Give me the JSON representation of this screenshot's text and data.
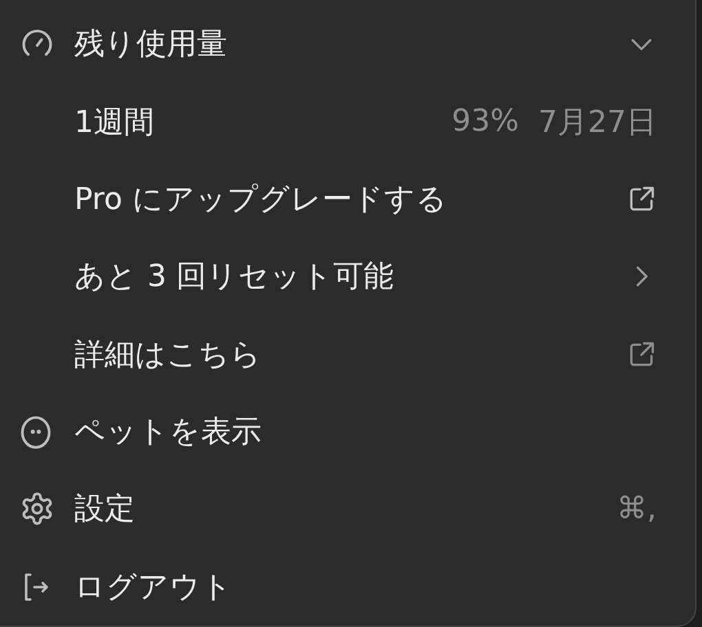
{
  "menu": {
    "items": [
      {
        "kind": "section",
        "label": "残り使用量",
        "expanded": true
      },
      {
        "kind": "usage",
        "label": "1週間",
        "percent": "93%",
        "date": "7月27日"
      },
      {
        "kind": "link",
        "label": "Pro にアップグレードする"
      },
      {
        "kind": "submenu",
        "label": "あと 3 回リセット可能"
      },
      {
        "kind": "link",
        "label": "詳細はこちら"
      },
      {
        "kind": "action",
        "label": "ペットを表示"
      },
      {
        "kind": "action",
        "label": "設定",
        "shortcut": "⌘,"
      },
      {
        "kind": "action",
        "label": "ログアウト"
      }
    ]
  }
}
